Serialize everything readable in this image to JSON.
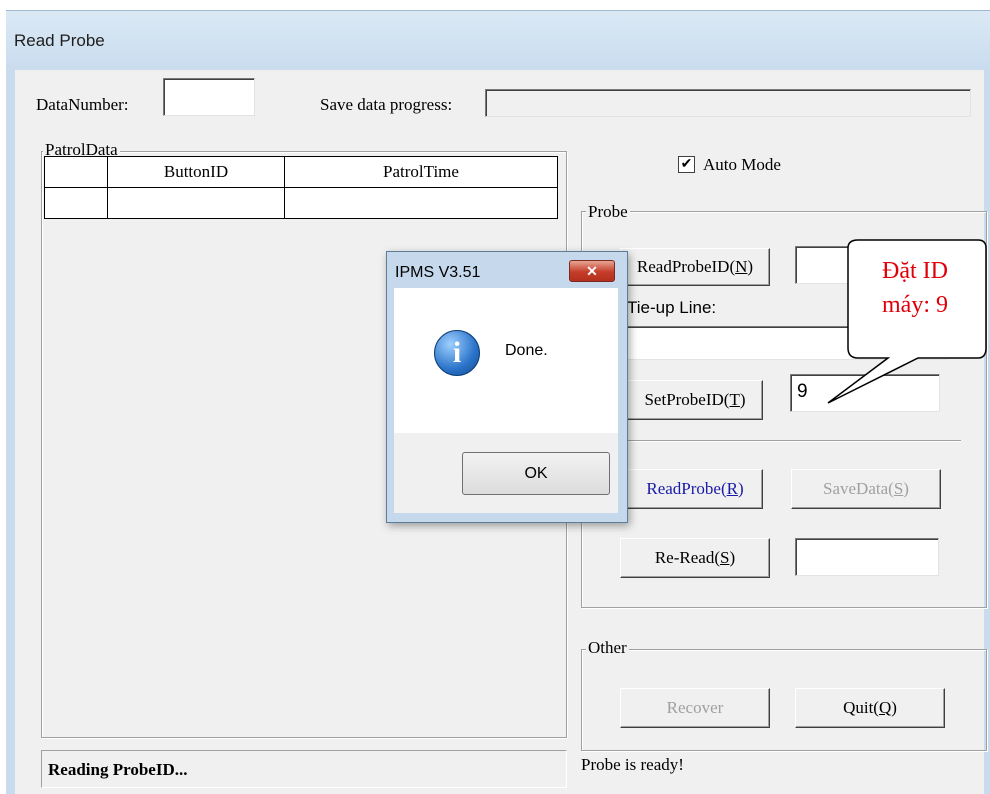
{
  "window": {
    "title": "Read Probe"
  },
  "top": {
    "data_number_label": "DataNumber:",
    "data_number_value": "",
    "save_progress_label": "Save data progress:",
    "save_progress_percent": 0
  },
  "patrol": {
    "group_label": "PatrolData",
    "columns": [
      "",
      "ButtonID",
      "PatrolTime"
    ],
    "rows": [
      [
        "",
        "",
        ""
      ]
    ]
  },
  "status_left": "Reading ProbeID...",
  "auto_mode": {
    "label": "Auto Mode",
    "checked": true,
    "check_glyph": "✔"
  },
  "probe": {
    "group_label": "Probe",
    "read_probe_id_label": "ReadProbeID",
    "read_probe_id_key": "N",
    "probe_id_value": "",
    "tie_up_label": "Tie-up Line:",
    "tie_up_value": "",
    "set_probe_id_label": "SetProbeID",
    "set_probe_id_key": "T",
    "set_probe_id_value": "9",
    "read_probe_label": "ReadProbe",
    "read_probe_key": "R",
    "save_data_label": "SaveData",
    "save_data_key": "S",
    "re_read_label": "Re-Read",
    "re_read_key": "S",
    "re_read_value": ""
  },
  "other": {
    "group_label": "Other",
    "recover_label": "Recover",
    "quit_label": "Quit",
    "quit_key": "Q"
  },
  "status_right": "Probe is ready!",
  "dialog": {
    "title": "IPMS V3.51",
    "close_glyph": "✕",
    "icon": "info-icon",
    "icon_glyph": "i",
    "message": "Done.",
    "ok_label": "OK"
  },
  "callout": {
    "line1": "Đặt ID",
    "line2": "máy: 9",
    "color": "#e0000a"
  }
}
